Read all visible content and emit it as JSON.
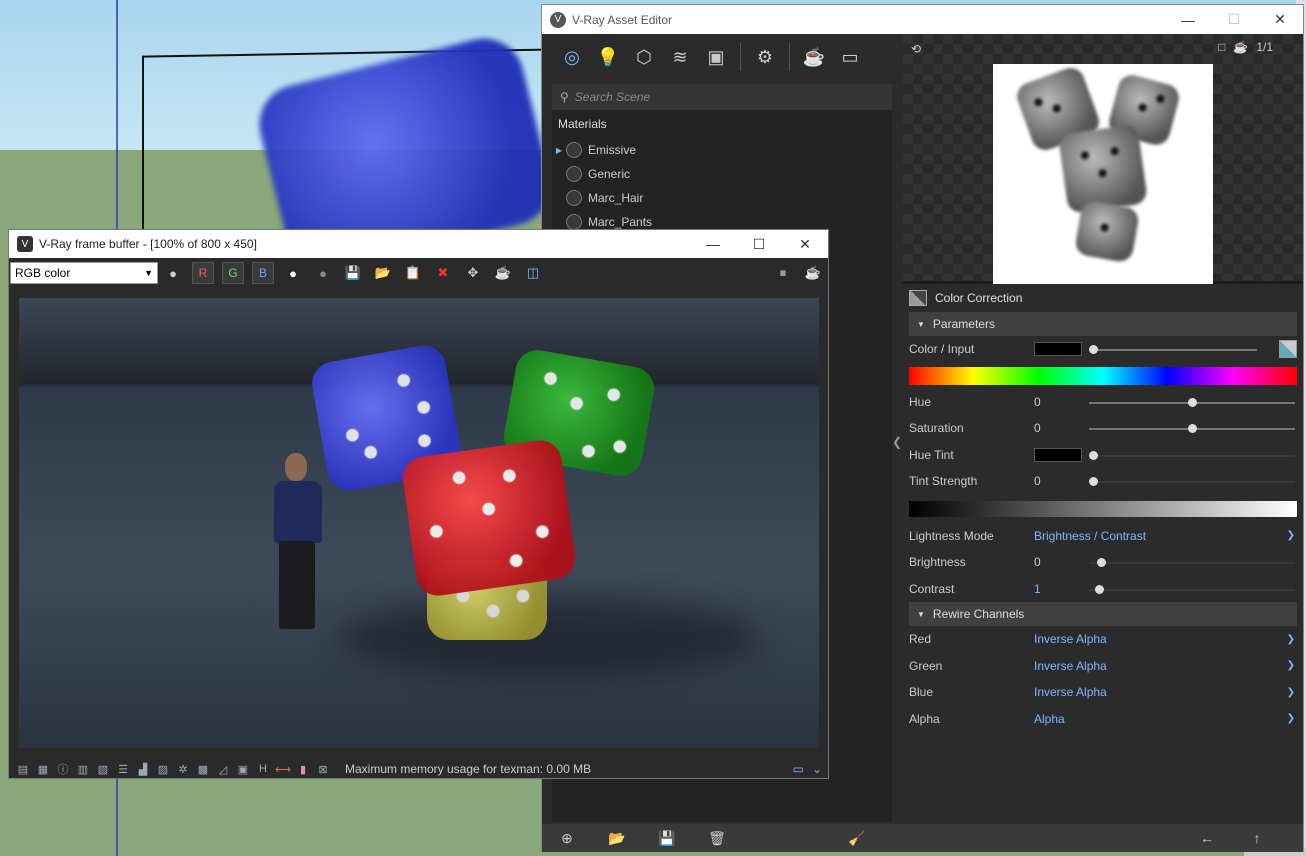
{
  "asset_editor": {
    "title": "V-Ray Asset Editor",
    "logo": "V",
    "window_buttons": [
      "—",
      "☐",
      "✕"
    ],
    "toolbar": [
      {
        "name": "materials-icon",
        "glyph": "◎"
      },
      {
        "name": "lights-icon",
        "glyph": "💡"
      },
      {
        "name": "geometry-icon",
        "glyph": "⬡"
      },
      {
        "name": "render-elements-icon",
        "glyph": "≋"
      },
      {
        "name": "textures-icon",
        "glyph": "▣"
      },
      {
        "name": "settings-icon",
        "glyph": "⚙"
      },
      {
        "name": "render-teapot-icon",
        "glyph": "☕"
      },
      {
        "name": "frame-buffer-icon",
        "glyph": "▭"
      }
    ],
    "search_placeholder": "Search Scene",
    "materials_title": "Materials",
    "materials": [
      "Emissive",
      "Generic",
      "Marc_Hair",
      "Marc_Pants"
    ],
    "preview_tools": [
      "□",
      "☕",
      "1/1"
    ],
    "preview_pin": "⟲",
    "panel_title": "Color Correction",
    "parameters_title": "Parameters",
    "params": {
      "color_input": "Color / Input",
      "hue": {
        "label": "Hue",
        "value": "0",
        "fraction": 0.5
      },
      "saturation": {
        "label": "Saturation",
        "value": "0",
        "fraction": 0.5
      },
      "hue_tint": "Hue Tint",
      "tint_strength": {
        "label": "Tint Strength",
        "value": "0"
      },
      "lightness_mode": {
        "label": "Lightness Mode",
        "value": "Brightness / Contrast"
      },
      "brightness": {
        "label": "Brightness",
        "value": "0"
      },
      "contrast": {
        "label": "Contrast",
        "value": "1"
      }
    },
    "rewire_title": "Rewire Channels",
    "rewire": {
      "red": {
        "label": "Red",
        "value": "Inverse Alpha"
      },
      "green": {
        "label": "Green",
        "value": "Inverse Alpha"
      },
      "blue": {
        "label": "Blue",
        "value": "Inverse Alpha"
      },
      "alpha": {
        "label": "Alpha",
        "value": "Alpha"
      }
    },
    "bottom_icons": [
      "⊕",
      "📂",
      "💾",
      "🗑",
      "🧹",
      "←",
      "↑"
    ]
  },
  "frame_buffer": {
    "title": "V-Ray frame buffer - [100% of 800 x 450]",
    "logo": "V",
    "window_buttons": [
      "—",
      "☐",
      "✕"
    ],
    "channel": "RGB color",
    "rgb": {
      "r": "R",
      "g": "G",
      "b": "B"
    },
    "status_text": "Maximum memory usage for texman: 0.00 MB"
  },
  "colors": {
    "accent": "#7fb6ff",
    "panel_bg": "#2b2b2b",
    "die_blue": "#3a44d8",
    "die_green": "#2a9a2a",
    "die_red": "#d0202a",
    "die_yellow": "#c8c040"
  }
}
